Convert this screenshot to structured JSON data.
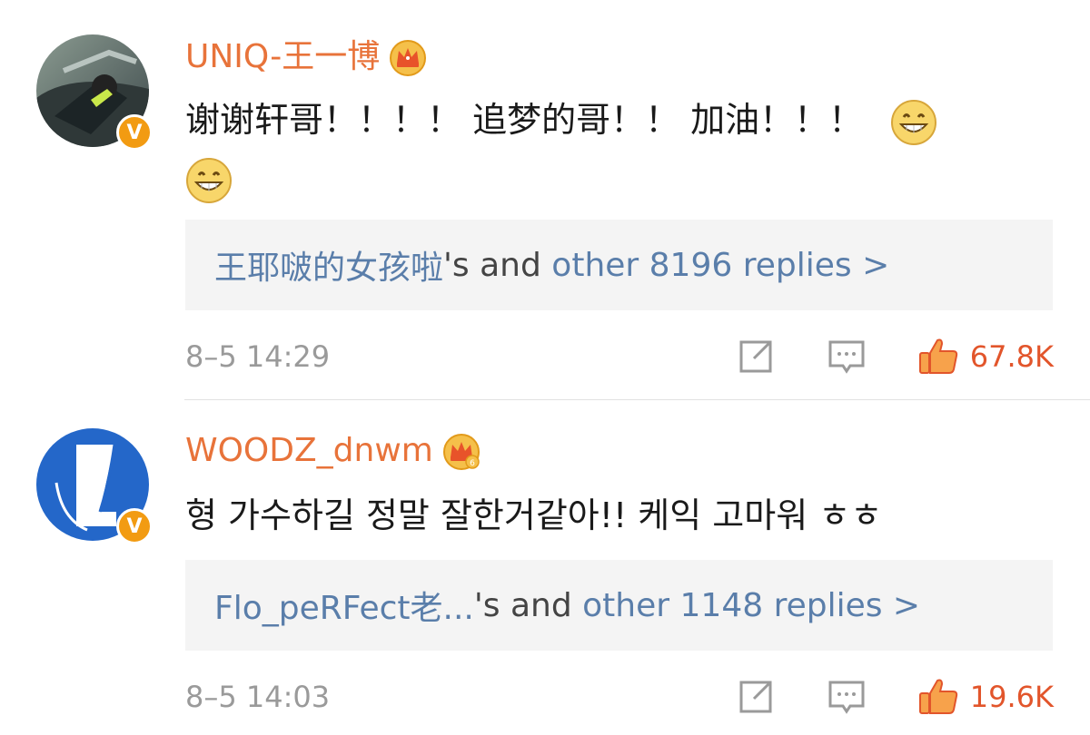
{
  "comments": [
    {
      "username": "UNIQ-王一博",
      "text": "谢谢轩哥！！！！ 追梦的哥！！ 加油！！！",
      "replies_user": "王耶啵的女孩啦",
      "replies_mid": "'s and ",
      "replies_tail": "other 8196 replies >",
      "timestamp": "8–5 14:29",
      "likes": "67.8K",
      "verified_badge": "V"
    },
    {
      "username": "WOODZ_dnwm",
      "text": "형 가수하길 정말 잘한거같아!! 케익 고마워 ㅎㅎ",
      "replies_user": "Flo_peRFect老...",
      "replies_mid": "'s and ",
      "replies_tail": "other 1148 replies >",
      "timestamp": "8–5 14:03",
      "likes": "19.6K",
      "verified_badge": "V"
    }
  ],
  "icons": {
    "crown": "crown-badge-icon",
    "share": "share-icon",
    "comment": "comment-icon",
    "like": "thumbs-up-icon",
    "emoji": "grin-emoji-icon"
  },
  "colors": {
    "username": "#e8733a",
    "link": "#5a7eaa",
    "like": "#e2552b",
    "badge": "#f29b12",
    "reply_bg": "#f4f4f4"
  }
}
